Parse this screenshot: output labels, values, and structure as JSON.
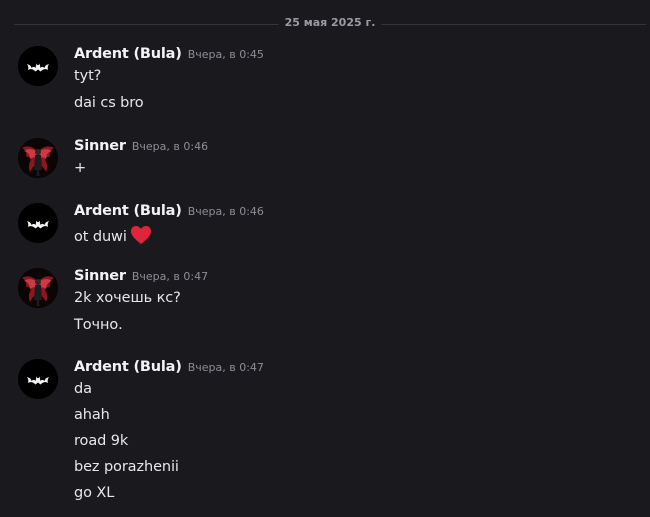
{
  "date_divider": "25 мая 2025 г.",
  "messages": [
    {
      "author": "Ardent (Bula)",
      "time": "Вчера, в 0:45",
      "avatar": "batman-logo-icon",
      "lines": [
        "tyt?",
        "dai cs bro"
      ]
    },
    {
      "author": "Sinner",
      "time": "Вчера, в 0:46",
      "avatar": "dark-angel-icon",
      "lines": [
        "+"
      ]
    },
    {
      "author": "Ardent (Bula)",
      "time": "Вчера, в 0:46",
      "avatar": "batman-logo-icon",
      "lines": [
        "ot duwi"
      ],
      "emoji": "red-heart-icon"
    },
    {
      "author": "Sinner",
      "time": "Вчера, в 0:47",
      "avatar": "dark-angel-icon",
      "lines": [
        "2k хочешь кс?",
        "Точно."
      ]
    },
    {
      "author": "Ardent (Bula)",
      "time": "Вчера, в 0:47",
      "avatar": "batman-logo-icon",
      "lines": [
        "da",
        "ahah",
        "road 9k",
        "bez porazhenii",
        "go XL"
      ]
    }
  ],
  "colors": {
    "background": "#1a1a1e",
    "username": "#f2f3f5",
    "timestamp": "#8c8e95",
    "text": "#e6e7ea",
    "heart": "#e0243a"
  }
}
